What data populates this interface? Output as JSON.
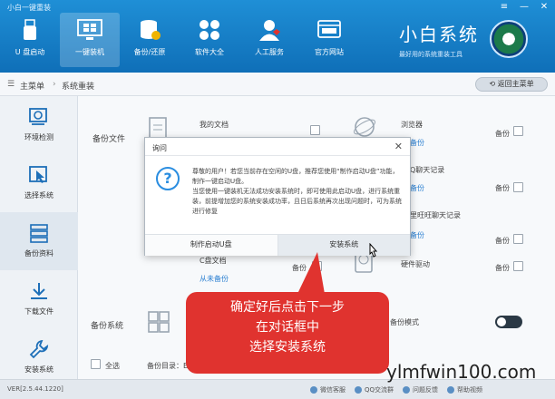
{
  "window": {
    "title": "小白一键重装"
  },
  "nav": {
    "items": [
      {
        "label": "U 盘启动",
        "icon": "usb-drive-icon"
      },
      {
        "label": "一键装机",
        "icon": "windows-monitor-icon",
        "active": true
      },
      {
        "label": "备份/还原",
        "icon": "database-icon"
      },
      {
        "label": "软件大全",
        "icon": "apps-grid-icon"
      },
      {
        "label": "人工服务",
        "icon": "support-person-icon"
      },
      {
        "label": "官方网站",
        "icon": "website-icon"
      }
    ]
  },
  "brand": {
    "title": "小白系统",
    "subtitle": "最好用的系统重装工具"
  },
  "breadcrumb": {
    "root": "主菜单",
    "current": "系统重装",
    "back_label": "返回主菜单"
  },
  "sidebar": {
    "items": [
      {
        "label": "环境检测"
      },
      {
        "label": "选择系统"
      },
      {
        "label": "备份资料",
        "active": true
      },
      {
        "label": "下载文件"
      },
      {
        "label": "安装系统"
      }
    ]
  },
  "content": {
    "backup_files_label": "备份文件",
    "my_docs": "我的文档",
    "browser": "浏览器",
    "browser_backup": "备份",
    "qq_chat": "Q聊天记录",
    "qq_backup": "备份",
    "wangwang_chat": "阿里旺旺聊天记录",
    "wangwang_backup": "备份",
    "c_docs": "C盘文档",
    "c_docs_status": "从未备份",
    "hardware_driver": "硬件驱动",
    "backup_short": "备份",
    "backup_system_label": "备份系统",
    "mode_label": "备份模式",
    "select_all": "全选",
    "backup_dir_label": "备份目录：E:\\"
  },
  "dialog": {
    "title": "询问",
    "message": [
      "尊敬的用户！若您当前存在空闲的U盘，推荐您使用“制作启动U盘”功能，制作一键启动U盘。",
      "当您使用一键装机无法成功安装系统时，即可使用此启动U盘，进行系统重装，前提增加您的系统安装成功率，且日后系统再次出现问题时，可为系统进行修复"
    ],
    "button_left": "制作启动U盘",
    "button_right": "安装系统"
  },
  "callout": {
    "lines": [
      "确定好后点击下一步",
      "在对话框中",
      "选择安装系统"
    ]
  },
  "footer": {
    "version": "VER[2.5.44.1220]",
    "links": [
      "微信客服",
      "QQ交流群",
      "问题反馈",
      "帮助视频"
    ]
  },
  "watermark": "ylmfwin100.com"
}
